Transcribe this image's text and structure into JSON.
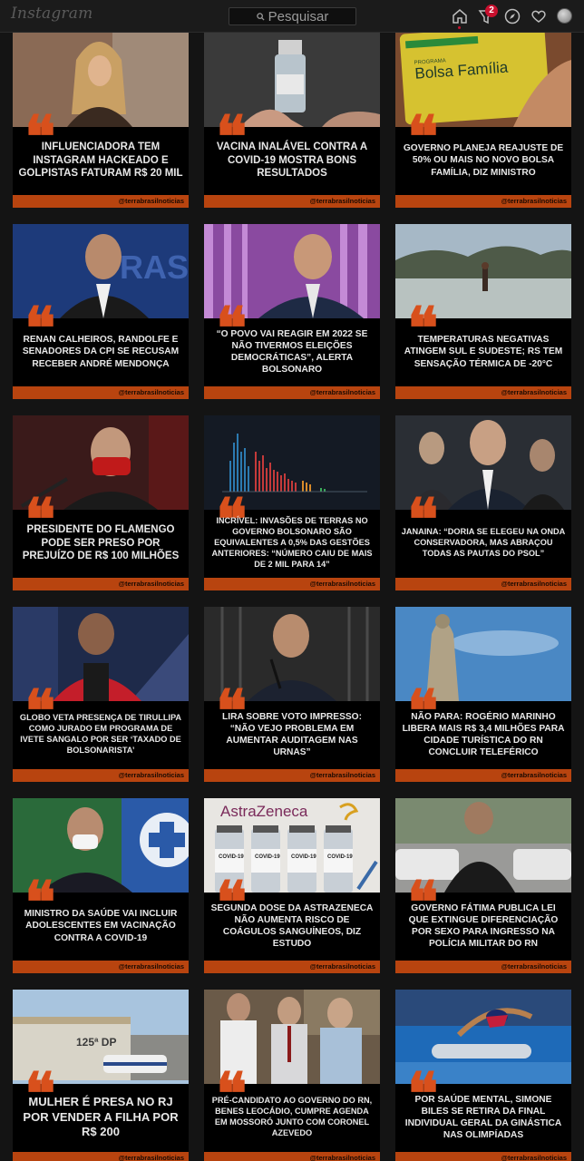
{
  "header": {
    "logo": "Instagram",
    "search_placeholder": "Pesquisar",
    "activity_badge": "2",
    "icons": [
      "home-icon",
      "direct-icon",
      "explore-icon",
      "heart-icon",
      "avatar"
    ]
  },
  "posts": [
    {
      "headline": "INFLUENCIADORA TEM INSTAGRAM HACKEADO E GOLPISTAS FATURAM R$ 20 MIL",
      "handle": "@terrabrasilnoticias",
      "size": "h-l"
    },
    {
      "headline": "VACINA INALÁVEL CONTRA A COVID-19 MOSTRA BONS RESULTADOS",
      "handle": "@terrabrasilnoticias",
      "size": "h-l"
    },
    {
      "headline": "GOVERNO PLANEJA REAJUSTE DE 50% OU MAIS NO NOVO BOLSA FAMÍLIA, DIZ MINISTRO",
      "handle": "@terrabrasilnoticias",
      "size": "h-m"
    },
    {
      "headline": "RENAN CALHEIROS, RANDOLFE E SENADORES DA CPI SE RECUSAM RECEBER ANDRÉ MENDONÇA",
      "handle": "@terrabrasilnoticias",
      "size": "h-m"
    },
    {
      "headline": "“O POVO VAI REAGIR EM 2022 SE NÃO TIVERMOS ELEIÇÕES DEMOCRÁTICAS”, ALERTA BOLSONARO",
      "handle": "@terrabrasilnoticias",
      "size": "h-m"
    },
    {
      "headline": "TEMPERATURAS NEGATIVAS ATINGEM SUL E SUDESTE; RS TEM SENSAÇÃO TÉRMICA DE -20°C",
      "handle": "@terrabrasilnoticias",
      "size": "h-m"
    },
    {
      "headline": "PRESIDENTE DO FLAMENGO PODE SER PRESO POR PREJUÍZO DE R$ 100 MILHÕES",
      "handle": "@terrabrasilnoticias",
      "size": "h-l"
    },
    {
      "headline": "INCRÍVEL: INVASÕES DE TERRAS NO GOVERNO BOLSONARO SÃO EQUIVALENTES A 0,5% DAS GESTÕES ANTERIORES: “NÚMERO CAIU DE MAIS DE 2 MIL PARA 14”",
      "handle": "@terrabrasilnoticias",
      "size": "h-s"
    },
    {
      "headline": "JANAINA: “DORIA SE ELEGEU NA ONDA CONSERVADORA, MAS ABRAÇOU TODAS AS PAUTAS DO PSOL”",
      "handle": "@terrabrasilnoticias",
      "size": "h-s"
    },
    {
      "headline": "GLOBO VETA PRESENÇA DE TIRULLIPA COMO JURADO EM PROGRAMA DE IVETE SANGALO POR SER ‘TAXADO DE BOLSONARISTA’",
      "handle": "@terrabrasilnoticias",
      "size": "h-s"
    },
    {
      "headline": "LIRA SOBRE VOTO IMPRESSO: “NÃO VEJO PROBLEMA EM AUMENTAR AUDITAGEM NAS URNAS”",
      "handle": "@terrabrasilnoticias",
      "size": "h-m"
    },
    {
      "headline": "NÃO PARA: ROGÉRIO MARINHO LIBERA MAIS R$ 3,4 MILHÕES PARA CIDADE TURÍSTICA DO RN CONCLUIR TELEFÉRICO",
      "handle": "@terrabrasilnoticias",
      "size": "h-m"
    },
    {
      "headline": "MINISTRO DA SAÚDE VAI INCLUIR ADOLESCENTES EM VACINAÇÃO CONTRA A COVID-19",
      "handle": "@terrabrasilnoticias",
      "size": "h-m"
    },
    {
      "headline": "SEGUNDA DOSE DA ASTRAZENECA NÃO AUMENTA RISCO DE COÁGULOS SANGUÍNEOS, DIZ ESTUDO",
      "handle": "@terrabrasilnoticias",
      "size": "h-m"
    },
    {
      "headline": "GOVERNO FÁTIMA PUBLICA LEI QUE EXTINGUE DIFERENCIAÇÃO POR SEXO PARA INGRESSO NA POLÍCIA MILITAR DO RN",
      "handle": "@terrabrasilnoticias",
      "size": "h-m"
    },
    {
      "headline": "MULHER É PRESA NO RJ POR VENDER A FILHA POR R$ 200",
      "handle": "@terrabrasilnoticias",
      "size": "h-xl"
    },
    {
      "headline": "PRÉ-CANDIDATO AO GOVERNO DO RN, BENES LEOCÁDIO, CUMPRE AGENDA EM MOSSORÓ JUNTO COM CORONEL AZEVEDO",
      "handle": "@terrabrasilnoticias",
      "size": "h-s"
    },
    {
      "headline": "POR SAÚDE MENTAL, SIMONE BILES SE RETIRA DA FINAL INDIVIDUAL GERAL DA GINÁSTICA NAS OLIMPÍADAS",
      "handle": "@terrabrasilnoticias",
      "size": "h-m"
    }
  ],
  "photo_texts": {
    "bolsa_card_title": "Bolsa Família",
    "bolsa_card_top": "PROGRAMA",
    "astrazeneca_logo": "AstraZeneca",
    "vial_label": "COVID-19",
    "police_sign": "125ª DP"
  },
  "colors": {
    "accent": "#d8501c",
    "footer": "#b8440f",
    "badge": "#c8102e"
  }
}
